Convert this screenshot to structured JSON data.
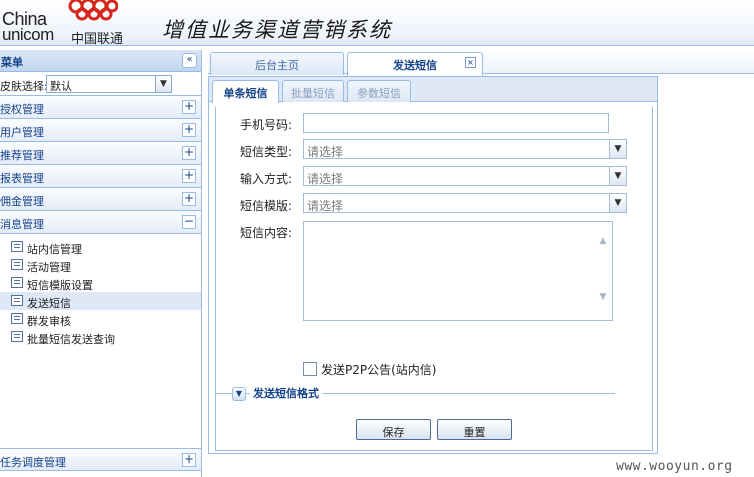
{
  "logo": {
    "line1": "China",
    "line2": "unicom",
    "cn": "中国联通"
  },
  "app": {
    "title": "增值业务渠道营销系统"
  },
  "menu": {
    "header": "菜单",
    "collapse": "«",
    "skin_label": "皮肤选择:",
    "skin_value": "默认",
    "sections": [
      {
        "label": "授权管理",
        "toggle": "+"
      },
      {
        "label": "用户管理",
        "toggle": "+"
      },
      {
        "label": "推荐管理",
        "toggle": "+"
      },
      {
        "label": "报表管理",
        "toggle": "+"
      },
      {
        "label": "佣金管理",
        "toggle": "+"
      },
      {
        "label": "消息管理",
        "toggle": "−"
      }
    ],
    "message_items": [
      {
        "label": "站内信管理"
      },
      {
        "label": "活动管理"
      },
      {
        "label": "短信模版设置"
      },
      {
        "label": "发送短信"
      },
      {
        "label": "群发审核"
      },
      {
        "label": "批量短信发送查询"
      }
    ],
    "last_section": {
      "label": "任务调度管理",
      "toggle": "+"
    }
  },
  "tabs": [
    {
      "label": "后台主页"
    },
    {
      "label": "发送短信",
      "close": "×"
    }
  ],
  "subtabs": [
    {
      "label": "单条短信"
    },
    {
      "label": "批量短信"
    },
    {
      "label": "参数短信"
    }
  ],
  "form": {
    "phone_label": "手机号码:",
    "phone_value": "",
    "type_label": "短信类型:",
    "type_value": "请选择",
    "input_label": "输入方式:",
    "input_value": "请选择",
    "template_label": "短信模版:",
    "template_value": "请选择",
    "content_label": "短信内容:",
    "content_value": "",
    "p2p_label": "发送P2P公告(站内信)",
    "format_label": "发送短信格式",
    "save": "保存",
    "reset": "重置"
  },
  "watermark": "www.wooyun.org"
}
